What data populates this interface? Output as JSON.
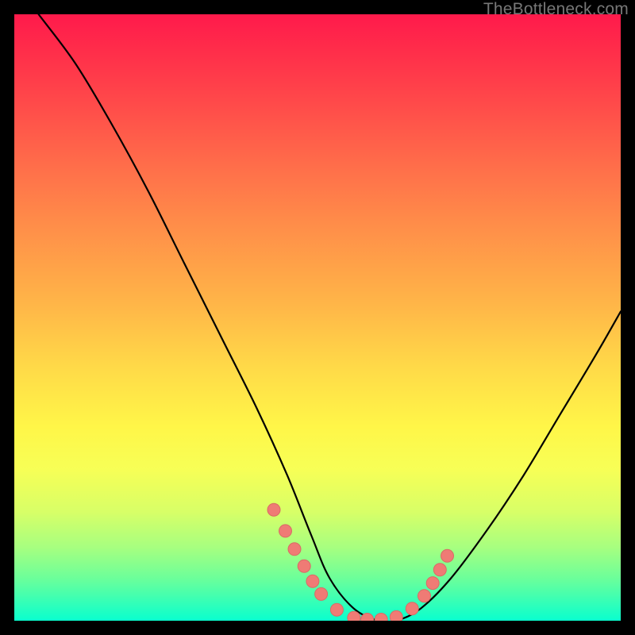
{
  "watermark": "TheBottleneck.com",
  "colors": {
    "curve": "#000000",
    "dot_fill": "#ef7b75",
    "dot_stroke": "#d96b65"
  },
  "chart_data": {
    "type": "line",
    "title": "",
    "xlabel": "",
    "ylabel": "",
    "xlim": [
      0,
      1
    ],
    "ylim": [
      0,
      1
    ],
    "series": [
      {
        "name": "curve",
        "x": [
          0.04,
          0.1,
          0.16,
          0.22,
          0.28,
          0.34,
          0.4,
          0.45,
          0.49,
          0.52,
          0.56,
          0.6,
          0.63,
          0.67,
          0.72,
          0.78,
          0.84,
          0.9,
          0.96,
          1.0
        ],
        "y": [
          1.0,
          0.92,
          0.82,
          0.71,
          0.59,
          0.47,
          0.35,
          0.24,
          0.14,
          0.07,
          0.02,
          0.0,
          0.0,
          0.02,
          0.07,
          0.15,
          0.24,
          0.34,
          0.44,
          0.51
        ]
      }
    ],
    "markers": {
      "name": "highlight-dots",
      "x": [
        0.428,
        0.447,
        0.462,
        0.478,
        0.492,
        0.506,
        0.532,
        0.56,
        0.582,
        0.605,
        0.63,
        0.656,
        0.676,
        0.69,
        0.702,
        0.714
      ],
      "y": [
        0.183,
        0.148,
        0.118,
        0.09,
        0.065,
        0.044,
        0.018,
        0.005,
        0.002,
        0.002,
        0.006,
        0.02,
        0.041,
        0.062,
        0.084,
        0.107
      ]
    }
  }
}
